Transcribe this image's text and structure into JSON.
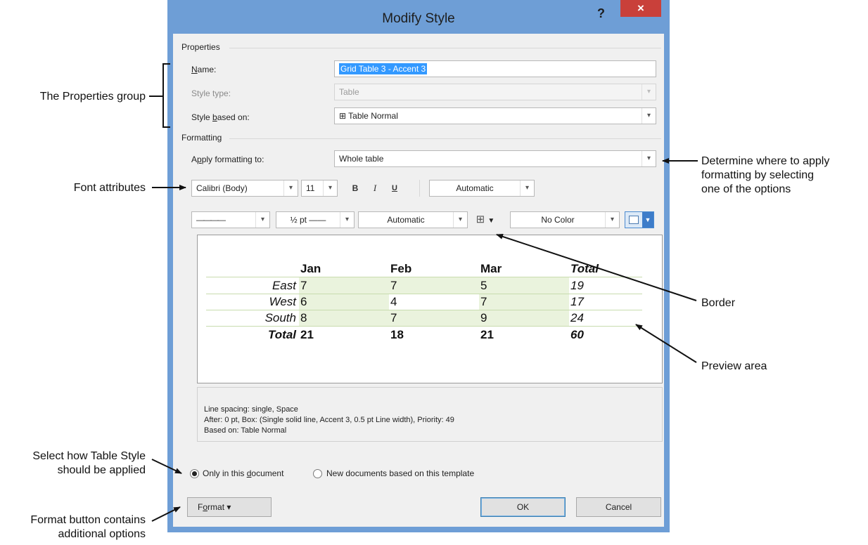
{
  "dialog": {
    "title": "Modify Style",
    "help": "?",
    "close": "×",
    "properties_header": "Properties",
    "name_label_u": "N",
    "name_label_rest": "ame:",
    "name_value": "Grid Table 3 - Accent 3",
    "style_type_label": "Style type:",
    "style_type_value": "Table",
    "based_on_label_pre": "Style ",
    "based_on_label_u": "b",
    "based_on_label_rest": "ased on:",
    "based_on_value": "⊞ Table Normal",
    "formatting_header": "Formatting",
    "apply_label_pre": "A",
    "apply_label_u": "p",
    "apply_label_rest": "ply formatting to:",
    "apply_value": "Whole table",
    "font_name": "Calibri (Body)",
    "font_size": "11",
    "bold": "B",
    "italic": "I",
    "underline": "U",
    "font_color": "Automatic",
    "line_style": "————",
    "line_weight": "½ pt ——",
    "border_color": "Automatic",
    "border_icon": "⊞",
    "shading": "No Color",
    "preview": {
      "headers": [
        "Jan",
        "Feb",
        "Mar",
        "Total"
      ],
      "rows": [
        {
          "label": "East",
          "values": [
            "7",
            "7",
            "5",
            "19"
          ]
        },
        {
          "label": "West",
          "values": [
            "6",
            "4",
            "7",
            "17"
          ]
        },
        {
          "label": "South",
          "values": [
            "8",
            "7",
            "9",
            "24"
          ]
        },
        {
          "label": "Total",
          "values": [
            "21",
            "18",
            "21",
            "60"
          ]
        }
      ]
    },
    "description": [
      "Line spacing:  single, Space",
      "After:  0 pt, Box: (Single solid line, Accent 3,  0.5 pt Line width), Priority: 49",
      "Based on: Table Normal"
    ],
    "radio_doc_pre": "Only in this ",
    "radio_doc_u": "d",
    "radio_doc_rest": "ocument",
    "radio_template": "New documents based on this template",
    "format_button_pre": "F",
    "format_button_u": "o",
    "format_button_rest": "rmat ▾",
    "ok_button": "OK",
    "cancel_button": "Cancel"
  },
  "annotations": {
    "properties_group": "The Properties group",
    "font_attributes": "Font attributes",
    "determine_1": "Determine where to apply",
    "determine_2": "formatting by selecting",
    "determine_3": "one of the options",
    "border": "Border",
    "preview_area": "Preview area",
    "select_how_1": "Select how Table Style",
    "select_how_2": "should be applied",
    "format_button_1": "Format button contains",
    "format_button_2": "additional options"
  },
  "colors": {
    "title_bar": "#6e9ed6",
    "close_button": "#c9403a",
    "selection": "#3399ff",
    "table_accent": "#eaf3dd"
  }
}
